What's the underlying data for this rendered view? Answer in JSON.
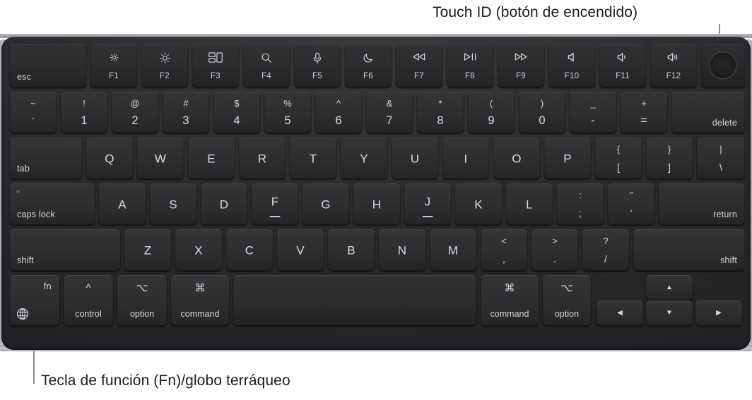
{
  "callouts": [
    {
      "id": "touchid",
      "text": "Touch ID (botón de encendido)"
    },
    {
      "id": "fn",
      "text": "Tecla de función (Fn)/globo terráqueo"
    }
  ],
  "keyboard": {
    "description": "Teclado MacBook con fila de funciones, Touch ID y teclas de flecha",
    "rows": {
      "function_row": [
        {
          "name": "esc",
          "label": "esc"
        },
        {
          "name": "f1",
          "glyph": "brightness-down-icon",
          "sub": "F1"
        },
        {
          "name": "f2",
          "glyph": "brightness-up-icon",
          "sub": "F2"
        },
        {
          "name": "f3",
          "glyph": "mission-control-icon",
          "sub": "F3"
        },
        {
          "name": "f4",
          "glyph": "spotlight-search-icon",
          "sub": "F4"
        },
        {
          "name": "f5",
          "glyph": "dictation-microphone-icon",
          "sub": "F5"
        },
        {
          "name": "f6",
          "glyph": "do-not-disturb-moon-icon",
          "sub": "F6"
        },
        {
          "name": "f7",
          "glyph": "rewind-icon",
          "sub": "F7"
        },
        {
          "name": "f8",
          "glyph": "play-pause-icon",
          "sub": "F8"
        },
        {
          "name": "f9",
          "glyph": "fast-forward-icon",
          "sub": "F9"
        },
        {
          "name": "f10",
          "glyph": "volume-mute-icon",
          "sub": "F10"
        },
        {
          "name": "f11",
          "glyph": "volume-down-icon",
          "sub": "F11"
        },
        {
          "name": "f12",
          "glyph": "volume-up-icon",
          "sub": "F12"
        },
        {
          "name": "touch-id",
          "glyph": "touch-id-icon",
          "sub": ""
        }
      ],
      "number_row": [
        {
          "name": "grave",
          "top": "~",
          "bottom": "`"
        },
        {
          "name": "1",
          "top": "!",
          "bottom": "1"
        },
        {
          "name": "2",
          "top": "@",
          "bottom": "2"
        },
        {
          "name": "3",
          "top": "#",
          "bottom": "3"
        },
        {
          "name": "4",
          "top": "$",
          "bottom": "4"
        },
        {
          "name": "5",
          "top": "%",
          "bottom": "5"
        },
        {
          "name": "6",
          "top": "^",
          "bottom": "6"
        },
        {
          "name": "7",
          "top": "&",
          "bottom": "7"
        },
        {
          "name": "8",
          "top": "*",
          "bottom": "8"
        },
        {
          "name": "9",
          "top": "(",
          "bottom": "9"
        },
        {
          "name": "0",
          "top": ")",
          "bottom": "0"
        },
        {
          "name": "minus",
          "top": "_",
          "bottom": "-"
        },
        {
          "name": "equal",
          "top": "+",
          "bottom": "="
        },
        {
          "name": "delete",
          "label": "delete"
        }
      ],
      "top_row": [
        {
          "name": "tab",
          "label": "tab"
        },
        {
          "name": "q",
          "label": "Q"
        },
        {
          "name": "w",
          "label": "W"
        },
        {
          "name": "e",
          "label": "E"
        },
        {
          "name": "r",
          "label": "R"
        },
        {
          "name": "t",
          "label": "T"
        },
        {
          "name": "y",
          "label": "Y"
        },
        {
          "name": "u",
          "label": "U"
        },
        {
          "name": "i",
          "label": "I"
        },
        {
          "name": "o",
          "label": "O"
        },
        {
          "name": "p",
          "label": "P"
        },
        {
          "name": "bracket-left",
          "top": "{",
          "bottom": "["
        },
        {
          "name": "bracket-right",
          "top": "}",
          "bottom": "]"
        },
        {
          "name": "backslash",
          "top": "|",
          "bottom": "\\"
        }
      ],
      "home_row": [
        {
          "name": "caps-lock",
          "label": "caps lock"
        },
        {
          "name": "a",
          "label": "A"
        },
        {
          "name": "s",
          "label": "S"
        },
        {
          "name": "d",
          "label": "D"
        },
        {
          "name": "f",
          "label": "F"
        },
        {
          "name": "g",
          "label": "G"
        },
        {
          "name": "h",
          "label": "H"
        },
        {
          "name": "j",
          "label": "J"
        },
        {
          "name": "k",
          "label": "K"
        },
        {
          "name": "l",
          "label": "L"
        },
        {
          "name": "semicolon",
          "top": ":",
          "bottom": ";"
        },
        {
          "name": "quote",
          "top": "\"",
          "bottom": "'"
        },
        {
          "name": "return",
          "label": "return"
        }
      ],
      "bottom_letter_row": [
        {
          "name": "shift-left",
          "label": "shift"
        },
        {
          "name": "z",
          "label": "Z"
        },
        {
          "name": "x",
          "label": "X"
        },
        {
          "name": "c",
          "label": "C"
        },
        {
          "name": "v",
          "label": "V"
        },
        {
          "name": "b",
          "label": "B"
        },
        {
          "name": "n",
          "label": "N"
        },
        {
          "name": "m",
          "label": "M"
        },
        {
          "name": "comma",
          "top": "<",
          "bottom": ","
        },
        {
          "name": "period",
          "top": ">",
          "bottom": "."
        },
        {
          "name": "slash",
          "top": "?",
          "bottom": "/"
        },
        {
          "name": "shift-right",
          "label": "shift"
        }
      ],
      "modifier_row": [
        {
          "name": "fn-globe",
          "label": "fn",
          "glyph": "globe-icon"
        },
        {
          "name": "control-left",
          "symbol": "^",
          "label": "control"
        },
        {
          "name": "option-left",
          "symbol": "⌥",
          "label": "option"
        },
        {
          "name": "command-left",
          "symbol": "⌘",
          "label": "command"
        },
        {
          "name": "space",
          "label": ""
        },
        {
          "name": "command-right",
          "symbol": "⌘",
          "label": "command"
        },
        {
          "name": "option-right",
          "symbol": "⌥",
          "label": "option"
        },
        {
          "name": "arrow-left",
          "glyph": "arrow-left-icon"
        },
        {
          "name": "arrow-up",
          "glyph": "arrow-up-icon"
        },
        {
          "name": "arrow-down",
          "glyph": "arrow-down-icon"
        },
        {
          "name": "arrow-right",
          "glyph": "arrow-right-icon"
        }
      ]
    }
  },
  "colors": {
    "page_background": "#ffffff",
    "chassis": "#2a2b2d",
    "key_face": "#2c2d2f",
    "key_text": "#d8d9db",
    "callout_text": "#1d1d1f",
    "leader_line": "#8c8c8f",
    "chassis_rim": "#c3c4c7"
  }
}
